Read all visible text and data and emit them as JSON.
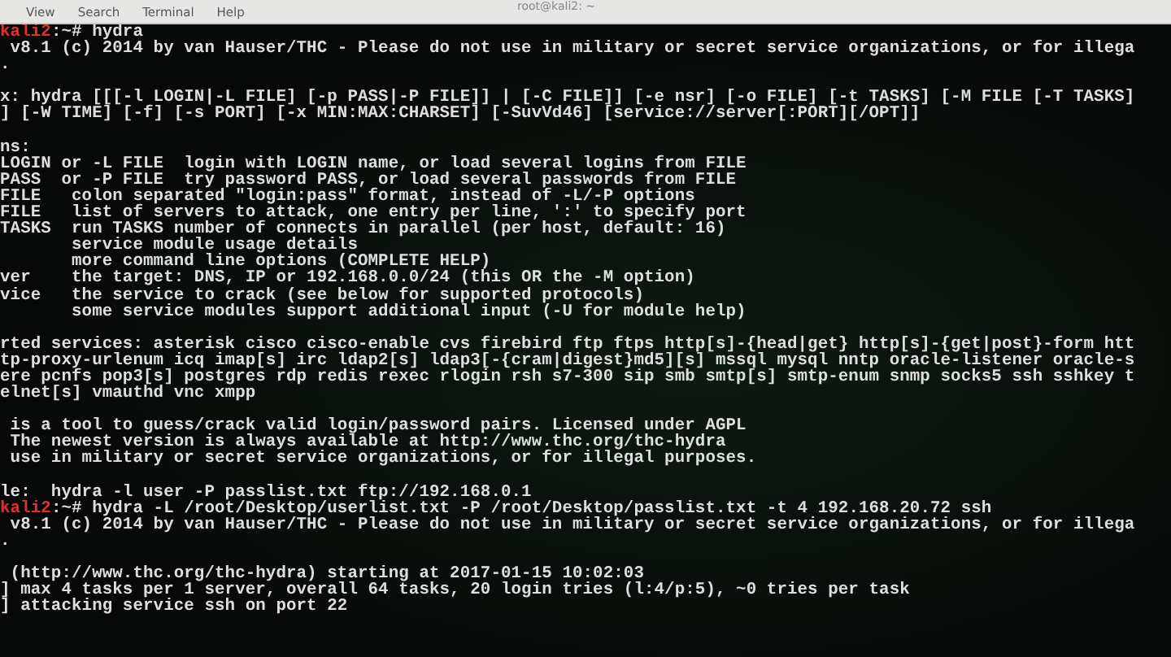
{
  "window": {
    "title": "root@kali2: ~"
  },
  "menu": [
    {
      "label": "View"
    },
    {
      "label": "Search"
    },
    {
      "label": "Terminal"
    },
    {
      "label": "Help"
    }
  ],
  "lines": [
    {
      "kind": "prompt",
      "host": "kali2",
      "text": ":~# hydra"
    },
    {
      "kind": "text",
      "text": " v8.1 (c) 2014 by van Hauser/THC - Please do not use in military or secret service organizations, or for illega"
    },
    {
      "kind": "text",
      "text": "."
    },
    {
      "kind": "blank"
    },
    {
      "kind": "text",
      "text": "x: hydra [[[-l LOGIN|-L FILE] [-p PASS|-P FILE]] | [-C FILE]] [-e nsr] [-o FILE] [-t TASKS] [-M FILE [-T TASKS]"
    },
    {
      "kind": "text",
      "text": "] [-W TIME] [-f] [-s PORT] [-x MIN:MAX:CHARSET] [-SuvVd46] [service://server[:PORT][/OPT]]"
    },
    {
      "kind": "blank"
    },
    {
      "kind": "text",
      "text": "ns:"
    },
    {
      "kind": "text",
      "text": "LOGIN or -L FILE  login with LOGIN name, or load several logins from FILE"
    },
    {
      "kind": "text",
      "text": "PASS  or -P FILE  try password PASS, or load several passwords from FILE"
    },
    {
      "kind": "text",
      "text": "FILE   colon separated \"login:pass\" format, instead of -L/-P options"
    },
    {
      "kind": "text",
      "text": "FILE   list of servers to attack, one entry per line, ':' to specify port"
    },
    {
      "kind": "text",
      "text": "TASKS  run TASKS number of connects in parallel (per host, default: 16)"
    },
    {
      "kind": "text",
      "text": "       service module usage details"
    },
    {
      "kind": "text",
      "text": "       more command line options (COMPLETE HELP)"
    },
    {
      "kind": "text",
      "text": "ver    the target: DNS, IP or 192.168.0.0/24 (this OR the -M option)"
    },
    {
      "kind": "text",
      "text": "vice   the service to crack (see below for supported protocols)"
    },
    {
      "kind": "text",
      "text": "       some service modules support additional input (-U for module help)"
    },
    {
      "kind": "blank"
    },
    {
      "kind": "text",
      "text": "rted services: asterisk cisco cisco-enable cvs firebird ftp ftps http[s]-{head|get} http[s]-{get|post}-form htt"
    },
    {
      "kind": "text",
      "text": "tp-proxy-urlenum icq imap[s] irc ldap2[s] ldap3[-{cram|digest}md5][s] mssql mysql nntp oracle-listener oracle-s"
    },
    {
      "kind": "text",
      "text": "ere pcnfs pop3[s] postgres rdp redis rexec rlogin rsh s7-300 sip smb smtp[s] smtp-enum snmp socks5 ssh sshkey t"
    },
    {
      "kind": "text",
      "text": "elnet[s] vmauthd vnc xmpp"
    },
    {
      "kind": "blank"
    },
    {
      "kind": "text",
      "text": " is a tool to guess/crack valid login/password pairs. Licensed under AGPL"
    },
    {
      "kind": "text",
      "text": " The newest version is always available at http://www.thc.org/thc-hydra"
    },
    {
      "kind": "text",
      "text": " use in military or secret service organizations, or for illegal purposes."
    },
    {
      "kind": "blank"
    },
    {
      "kind": "text",
      "text": "le:  hydra -l user -P passlist.txt ftp://192.168.0.1"
    },
    {
      "kind": "prompt",
      "host": "kali2",
      "text": ":~# hydra -L /root/Desktop/userlist.txt -P /root/Desktop/passlist.txt -t 4 192.168.20.72 ssh"
    },
    {
      "kind": "text",
      "text": " v8.1 (c) 2014 by van Hauser/THC - Please do not use in military or secret service organizations, or for illega"
    },
    {
      "kind": "text",
      "text": "."
    },
    {
      "kind": "blank"
    },
    {
      "kind": "text",
      "text": " (http://www.thc.org/thc-hydra) starting at 2017-01-15 10:02:03"
    },
    {
      "kind": "text",
      "text": "] max 4 tasks per 1 server, overall 64 tasks, 20 login tries (l:4/p:5), ~0 tries per task"
    },
    {
      "kind": "text",
      "text": "] attacking service ssh on port 22"
    }
  ]
}
